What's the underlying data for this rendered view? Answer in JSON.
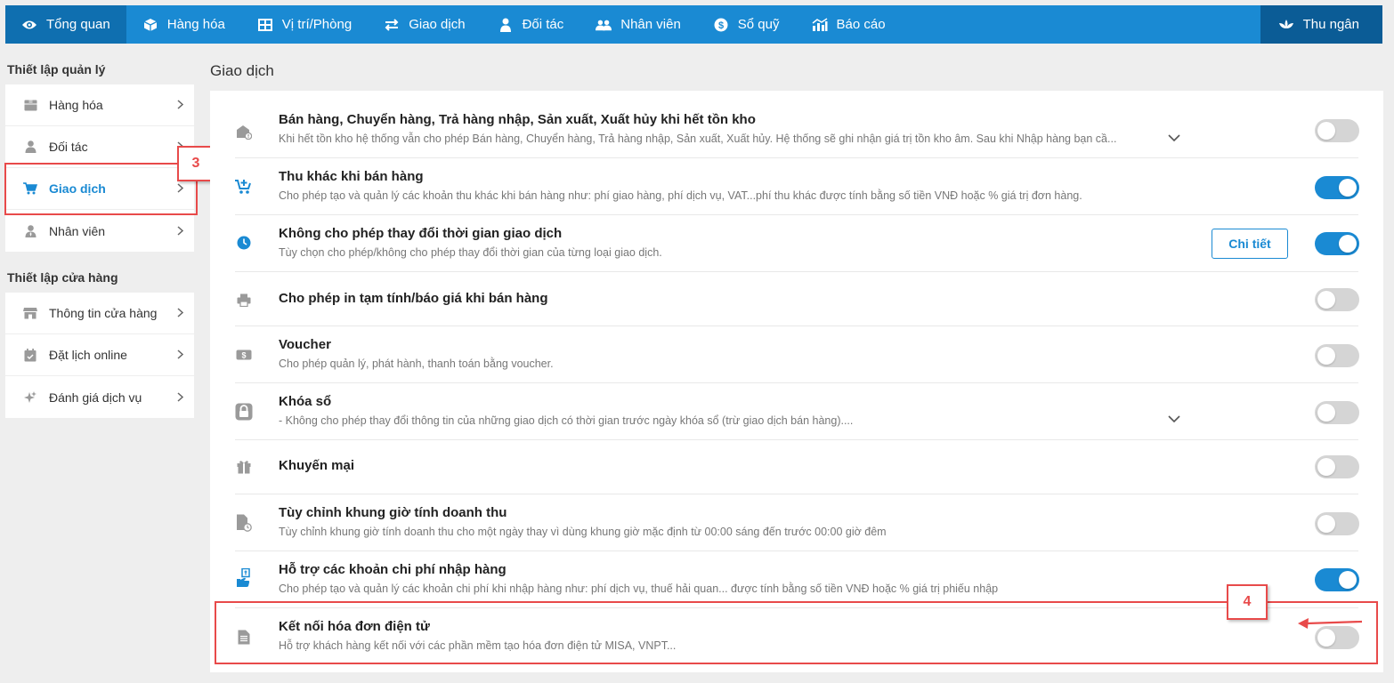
{
  "nav": {
    "items": [
      {
        "label": "Tổng quan",
        "icon": "eye-icon",
        "name": "nav-tong-quan"
      },
      {
        "label": "Hàng hóa",
        "icon": "box-icon",
        "name": "nav-hang-hoa"
      },
      {
        "label": "Vị trí/Phòng",
        "icon": "grid-icon",
        "name": "nav-vi-tri-phong"
      },
      {
        "label": "Giao dịch",
        "icon": "exchange-icon",
        "name": "nav-giao-dich"
      },
      {
        "label": "Đối tác",
        "icon": "person-icon",
        "name": "nav-doi-tac"
      },
      {
        "label": "Nhân viên",
        "icon": "people-icon",
        "name": "nav-nhan-vien"
      },
      {
        "label": "Sổ quỹ",
        "icon": "dollar-icon",
        "name": "nav-so-quy"
      },
      {
        "label": "Báo cáo",
        "icon": "chart-icon",
        "name": "nav-bao-cao"
      }
    ],
    "cashier": {
      "label": "Thu ngân",
      "icon": "lotus-icon"
    },
    "accent": "#1a8ad3"
  },
  "sidebar": {
    "section1_title": "Thiết lập quản lý",
    "section1_items": [
      {
        "label": "Hàng hóa",
        "icon": "box-icon"
      },
      {
        "label": "Đối tác",
        "icon": "person-icon"
      },
      {
        "label": "Giao dịch",
        "icon": "cart-icon",
        "active": true
      },
      {
        "label": "Nhân viên",
        "icon": "user-tie-icon"
      }
    ],
    "section2_title": "Thiết lập cửa hàng",
    "section2_items": [
      {
        "label": "Thông tin cửa hàng",
        "icon": "store-icon"
      },
      {
        "label": "Đặt lịch online",
        "icon": "calendar-icon"
      },
      {
        "label": "Đánh giá dịch vụ",
        "icon": "sparkle-icon"
      }
    ]
  },
  "annotations": {
    "step3": "3",
    "step4": "4"
  },
  "main": {
    "title": "Giao dịch",
    "settings": [
      {
        "title": "Bán hàng, Chuyển hàng, Trả hàng nhập, Sản xuất, Xuất hủy khi hết tồn kho",
        "desc": "Khi hết tồn kho hệ thống vẫn cho phép Bán hàng, Chuyển hàng, Trả hàng nhập, Sản xuất, Xuất hủy. Hệ thống sẽ ghi nhận giá trị tồn kho âm. Sau khi Nhập hàng bạn cầ...",
        "on": false,
        "icon": "warehouse-alert-icon",
        "expandable": true
      },
      {
        "title": "Thu khác khi bán hàng",
        "desc": "Cho phép tạo và quản lý các khoản thu khác khi bán hàng như: phí giao hàng, phí dịch vụ, VAT...phí thu khác được tính bằng số tiền VNĐ hoặc % giá trị đơn hàng.",
        "on": true,
        "icon": "cart-plus-icon"
      },
      {
        "title": "Không cho phép thay đổi thời gian giao dịch",
        "desc": "Tùy chọn cho phép/không cho phép thay đổi thời gian của từng loại giao dịch.",
        "on": true,
        "icon": "clock-icon",
        "detail_label": "Chi tiết"
      },
      {
        "title": "Cho phép in tạm tính/báo giá khi bán hàng",
        "desc": "",
        "on": false,
        "icon": "printer-icon"
      },
      {
        "title": "Voucher",
        "desc": "Cho phép quản lý, phát hành, thanh toán bằng voucher.",
        "on": false,
        "icon": "voucher-icon"
      },
      {
        "title": "Khóa sổ",
        "desc": "- Không cho phép thay đổi thông tin của những giao dịch có thời gian trước ngày khóa sổ (trừ giao dịch bán hàng)....",
        "on": false,
        "icon": "lock-icon",
        "expandable": true
      },
      {
        "title": "Khuyến mại",
        "desc": "",
        "on": false,
        "icon": "gift-icon"
      },
      {
        "title": "Tùy chỉnh khung giờ tính doanh thu",
        "desc": "Tùy chỉnh khung giờ tính doanh thu cho một ngày thay vì dùng khung giờ mặc định từ 00:00 sáng đến trước 00:00 giờ đêm",
        "on": false,
        "icon": "file-clock-icon"
      },
      {
        "title": "Hỗ trợ các khoản chi phí nhập hàng",
        "desc": "Cho phép tạo và quản lý các khoản chi phí khi nhập hàng như: phí dịch vụ, thuế hải quan... được tính bằng số tiền VNĐ hoặc % giá trị phiếu nhập",
        "on": true,
        "icon": "import-cost-icon"
      },
      {
        "title": "Kết nối hóa đơn điện tử",
        "desc": "Hỗ trợ khách hàng kết nối với các phần mềm tạo hóa đơn điện tử MISA, VNPT...",
        "on": false,
        "icon": "document-icon"
      }
    ]
  }
}
